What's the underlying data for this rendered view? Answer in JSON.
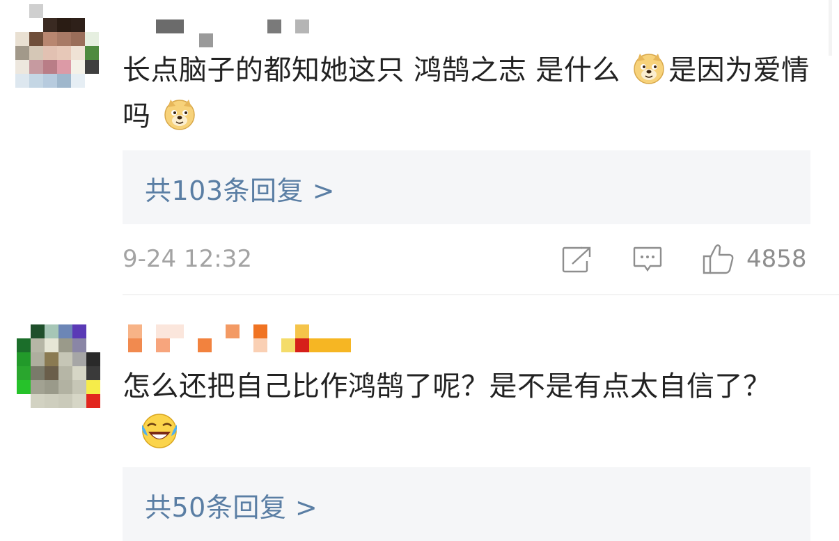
{
  "comments": [
    {
      "text": "长点脑子的都知她这只 鸿鹄之志 是什么",
      "text_cont": "是因为爱情吗",
      "emoji_1": "doge-icon",
      "emoji_2": "doge-icon",
      "reply_label": "共103条回复 >",
      "time": "9-24 12:32",
      "like_count": "4858"
    },
    {
      "text": "怎么还把自己比作鸿鹄了呢？是不是有点太自信了？",
      "emoji": "laughing-crying-icon",
      "reply_label": "共50条回复 >"
    }
  ],
  "colors": {
    "text": "#222222",
    "link": "#5a7ea4",
    "meta": "#a3a3a3",
    "reply_bg": "#f5f6f8",
    "divider": "#e6e6e6"
  }
}
